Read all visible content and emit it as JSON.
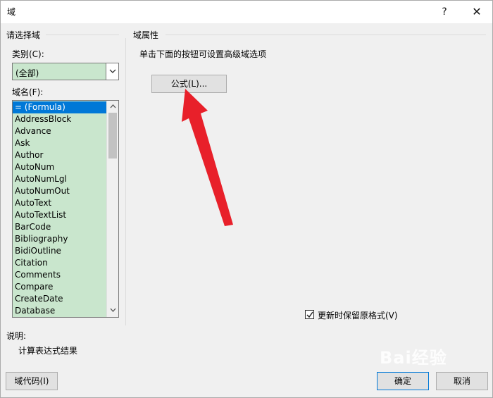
{
  "window": {
    "title": "域",
    "help": "?",
    "close": "✕"
  },
  "left": {
    "group_title": "请选择域",
    "category_label": "类别(C):",
    "category_value": "(全部)",
    "field_names_label": "域名(F):",
    "field_names": [
      "= (Formula)",
      "AddressBlock",
      "Advance",
      "Ask",
      "Author",
      "AutoNum",
      "AutoNumLgl",
      "AutoNumOut",
      "AutoText",
      "AutoTextList",
      "BarCode",
      "Bibliography",
      "BidiOutline",
      "Citation",
      "Comments",
      "Compare",
      "CreateDate",
      "Database"
    ],
    "selected_index": 0
  },
  "right": {
    "group_title": "域属性",
    "hint": "单击下面的按钮可设置高级域选项",
    "formula_button": "公式(L)...",
    "preserve_format_label": "更新时保留原格式(V)",
    "preserve_format_checked": true
  },
  "description": {
    "label": "说明:",
    "text": "计算表达式结果"
  },
  "footer": {
    "field_codes_button": "域代码(I)",
    "ok_button": "确定",
    "cancel_button": "取消"
  },
  "colors": {
    "list_bg": "#c9e6cd",
    "selection": "#0078d7",
    "annotation_arrow": "#e8202a"
  },
  "watermark": "Bai经验"
}
